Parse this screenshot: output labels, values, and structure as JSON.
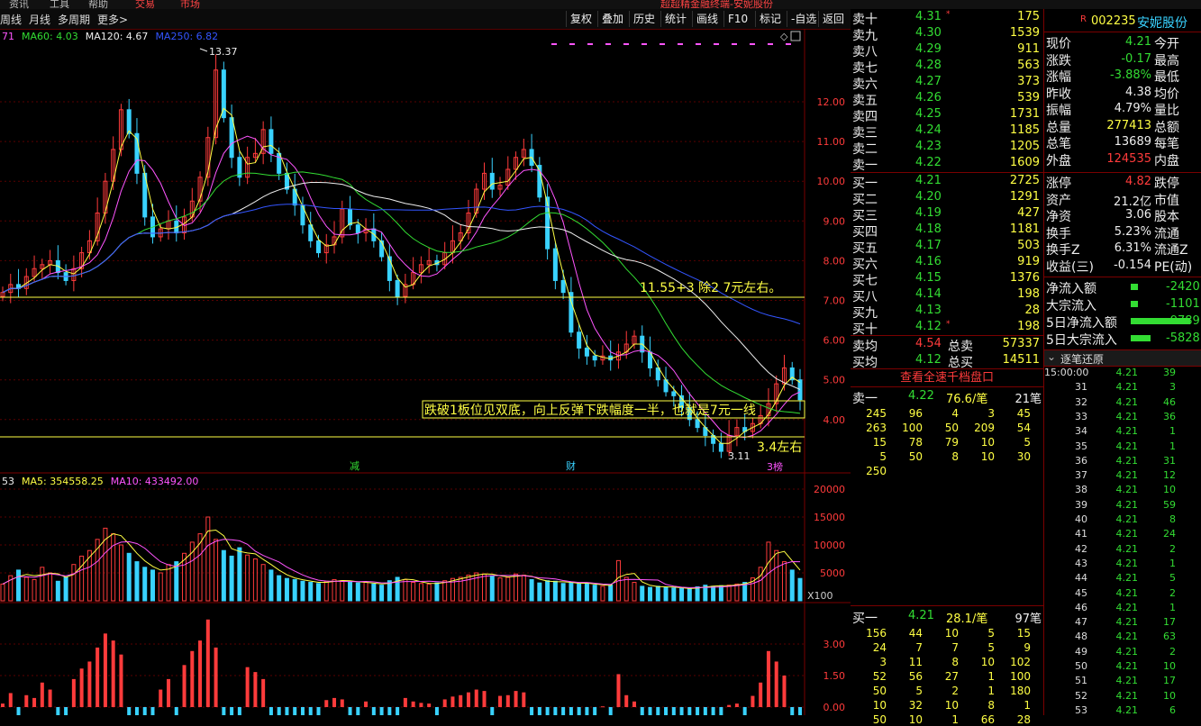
{
  "toolbar": {
    "period_tabs": [
      "周线",
      "月线",
      "多周期",
      "更多>"
    ],
    "buttons": [
      "复权",
      "叠加",
      "历史",
      "统计",
      "画线",
      "F10",
      "标记",
      "-自选",
      "返回"
    ]
  },
  "topbar": {
    "items": [
      "资讯",
      "工具",
      "帮助"
    ],
    "alerts": [
      "交易",
      "市场"
    ],
    "title": "超超精金融终端-安妮股份"
  },
  "chart": {
    "ma_legend": [
      {
        "text": "71",
        "color": "#ff55ff"
      },
      {
        "text": "MA60: 4.03",
        "color": "#33dd33"
      },
      {
        "text": "MA120: 4.67",
        "color": "#eeeeee"
      },
      {
        "text": "MA250: 6.82",
        "color": "#3355ff"
      }
    ],
    "vol_legend": [
      {
        "text": "53",
        "color": "#eeeeee"
      },
      {
        "text": "MA5: 354558.25",
        "color": "#ffff44"
      },
      {
        "text": "MA10: 433492.00",
        "color": "#ff55ff"
      }
    ],
    "high_label": "13.37",
    "low_label": "3.11",
    "annotation_1": "11.55+3  除2  7元左右。",
    "annotation_2": "跌破1板位见双底，向上反弹下跌幅度一半，也就是7元一线",
    "annotation_3": "3.4左右",
    "event_markers": [
      "减",
      "财",
      "3榜"
    ],
    "price_ticks": [
      "12.00",
      "11.00",
      "10.00",
      "9.00",
      "8.00",
      "7.00",
      "6.00",
      "5.00",
      "4.00"
    ],
    "vol_ticks": [
      "20000",
      "15000",
      "10000",
      "5000"
    ],
    "vol_unit": "X100",
    "ind_ticks": [
      "3.00",
      "1.50",
      "0.00"
    ]
  },
  "chart_data": {
    "type": "candlestick",
    "price_axis": {
      "min": 3.0,
      "max": 13.5
    },
    "close": [
      7.2,
      7.4,
      7.3,
      7.6,
      7.8,
      7.9,
      8.0,
      7.7,
      7.5,
      7.8,
      8.2,
      8.5,
      9.2,
      10.0,
      10.8,
      11.8,
      11.2,
      10.2,
      9.1,
      8.6,
      8.8,
      9.0,
      8.7,
      9.1,
      9.5,
      10.1,
      11.1,
      12.8,
      11.6,
      10.6,
      10.1,
      10.6,
      10.7,
      11.3,
      10.7,
      10.2,
      9.8,
      9.4,
      8.9,
      8.5,
      8.2,
      8.4,
      8.6,
      9.3,
      8.9,
      8.7,
      8.8,
      8.5,
      8.1,
      7.5,
      7.1,
      7.4,
      7.7,
      7.9,
      8.0,
      7.9,
      8.2,
      8.5,
      8.7,
      9.2,
      9.8,
      10.2,
      9.8,
      9.9,
      10.3,
      10.6,
      10.8,
      10.4,
      9.6,
      8.3,
      7.5,
      7.2,
      6.2,
      5.8,
      5.6,
      5.5,
      5.6,
      5.5,
      5.7,
      5.9,
      6.1,
      5.7,
      5.3,
      5.0,
      4.7,
      4.6,
      4.3,
      4.0,
      3.8,
      3.6,
      3.4,
      3.2,
      3.6,
      3.8,
      3.7,
      3.9,
      4.1,
      4.4,
      4.9,
      5.3,
      5.0,
      4.5
    ],
    "volume_axis": {
      "min": 0,
      "max": 21000
    },
    "volume": [
      3000,
      4500,
      5500,
      4200,
      3800,
      6000,
      5000,
      3500,
      4200,
      6500,
      8000,
      9000,
      11000,
      13000,
      12000,
      10000,
      8500,
      7000,
      6000,
      5500,
      5000,
      6500,
      7000,
      8500,
      10500,
      12000,
      15000,
      11000,
      9000,
      8000,
      9500,
      8200,
      7500,
      6500,
      5500,
      4500,
      4000,
      3800,
      3500,
      3300,
      3100,
      3500,
      3800,
      3600,
      3400,
      3200,
      3300,
      3000,
      2800,
      3600,
      4200,
      3800,
      3300,
      3100,
      3000,
      3200,
      3600,
      4000,
      4200,
      4600,
      5000,
      4800,
      4500,
      4100,
      4200,
      4800,
      4600,
      3800,
      3200,
      3600,
      3500,
      3100,
      3300,
      3000,
      3200,
      2800,
      2600,
      2800,
      7200,
      4200,
      3300,
      2600,
      2400,
      2600,
      2500,
      2300,
      2200,
      2100,
      2500,
      2800,
      2600,
      2700,
      2800,
      3000,
      3300,
      4100,
      6000,
      10500,
      9000,
      7000,
      5500,
      4000
    ]
  },
  "orderbook": {
    "sell": [
      {
        "label": "卖十",
        "price": "4.31",
        "vol": "175",
        "mark": "*"
      },
      {
        "label": "卖九",
        "price": "4.30",
        "vol": "1539"
      },
      {
        "label": "卖八",
        "price": "4.29",
        "vol": "911"
      },
      {
        "label": "卖七",
        "price": "4.28",
        "vol": "563"
      },
      {
        "label": "卖六",
        "price": "4.27",
        "vol": "373"
      },
      {
        "label": "卖五",
        "price": "4.26",
        "vol": "539"
      },
      {
        "label": "卖四",
        "price": "4.25",
        "vol": "1731"
      },
      {
        "label": "卖三",
        "price": "4.24",
        "vol": "1185"
      },
      {
        "label": "卖二",
        "price": "4.23",
        "vol": "1205"
      },
      {
        "label": "卖一",
        "price": "4.22",
        "vol": "1609"
      }
    ],
    "buy": [
      {
        "label": "买一",
        "price": "4.21",
        "vol": "2725"
      },
      {
        "label": "买二",
        "price": "4.20",
        "vol": "1291"
      },
      {
        "label": "买三",
        "price": "4.19",
        "vol": "427"
      },
      {
        "label": "买四",
        "price": "4.18",
        "vol": "1181"
      },
      {
        "label": "买五",
        "price": "4.17",
        "vol": "503"
      },
      {
        "label": "买六",
        "price": "4.16",
        "vol": "919"
      },
      {
        "label": "买七",
        "price": "4.15",
        "vol": "1376"
      },
      {
        "label": "买八",
        "price": "4.14",
        "vol": "198"
      },
      {
        "label": "买九",
        "price": "4.13",
        "vol": "28"
      },
      {
        "label": "买十",
        "price": "4.12",
        "vol": "198",
        "mark": "*"
      }
    ],
    "avg": [
      {
        "label": "卖均",
        "price": "4.54",
        "total_label": "总卖",
        "total": "57337"
      },
      {
        "label": "买均",
        "price": "4.12",
        "total_label": "总买",
        "total": "14511"
      }
    ]
  },
  "depth": {
    "header": "查看全速千档盘口",
    "sell_head": {
      "label": "卖一",
      "price": "4.22",
      "avg": "76.6/笔",
      "count": "21笔"
    },
    "sell_grid": [
      [
        "245",
        "96",
        "4",
        "3",
        "45"
      ],
      [
        "263",
        "100",
        "50",
        "209",
        "54"
      ],
      [
        "15",
        "78",
        "79",
        "10",
        "5"
      ],
      [
        "5",
        "50",
        "8",
        "10",
        "30"
      ],
      [
        "250",
        "",
        "",
        "",
        ""
      ]
    ],
    "buy_head": {
      "label": "买一",
      "price": "4.21",
      "avg": "28.1/笔",
      "count": "97笔"
    },
    "buy_grid": [
      [
        "156",
        "44",
        "10",
        "5",
        "15"
      ],
      [
        "24",
        "7",
        "7",
        "5",
        "9"
      ],
      [
        "3",
        "11",
        "8",
        "10",
        "102"
      ],
      [
        "52",
        "56",
        "27",
        "1",
        "100"
      ],
      [
        "50",
        "5",
        "2",
        "1",
        "180"
      ],
      [
        "10",
        "32",
        "10",
        "8",
        "1"
      ],
      [
        "50",
        "10",
        "1",
        "66",
        "28"
      ]
    ]
  },
  "quote": {
    "code": "002235",
    "name": "安妮股份",
    "rows": [
      {
        "l": "现价",
        "v": "4.21",
        "vc": "#33dd33",
        "r": "今开"
      },
      {
        "l": "涨跌",
        "v": "-0.17",
        "vc": "#33dd33",
        "r": "最高"
      },
      {
        "l": "涨幅",
        "v": "-3.88%",
        "vc": "#33dd33",
        "r": "最低"
      },
      {
        "l": "昨收",
        "v": "4.38",
        "vc": "#eeeeee",
        "r": "均价"
      },
      {
        "l": "振幅",
        "v": "4.79%",
        "vc": "#eeeeee",
        "r": "量比"
      },
      {
        "l": "总量",
        "v": "277413",
        "vc": "#ffff44",
        "r": "总额"
      },
      {
        "l": "总笔",
        "v": "13689",
        "vc": "#eeeeee",
        "r": "每笔"
      },
      {
        "l": "外盘",
        "v": "124535",
        "vc": "#ff3b3b",
        "r": "内盘"
      }
    ],
    "rows2": [
      {
        "l": "涨停",
        "v": "4.82",
        "vc": "#ff3b3b",
        "r": "跌停"
      },
      {
        "l": "资产",
        "v": "21.2亿",
        "vc": "#eeeeee",
        "r": "市值"
      },
      {
        "l": "净资",
        "v": "3.06",
        "vc": "#eeeeee",
        "r": "股本"
      },
      {
        "l": "换手",
        "v": "5.23%",
        "vc": "#eeeeee",
        "r": "流通"
      },
      {
        "l": "换手Z",
        "v": "6.31%",
        "vc": "#eeeeee",
        "r": "流通Z"
      },
      {
        "l": "收益(三)",
        "v": "-0.154",
        "vc": "#eeeeee",
        "r": "PE(动)"
      }
    ],
    "flows": [
      {
        "l": "净流入额",
        "v": "-2420"
      },
      {
        "l": "大宗流入",
        "v": "-1101"
      },
      {
        "l": "5日净流入额",
        "v": "-9789"
      },
      {
        "l": "5日大宗流入",
        "v": "-5828"
      }
    ],
    "ticks_header": "逐笔还原",
    "ticks": [
      [
        "15:00:00",
        "4.21",
        "39"
      ],
      [
        "31",
        "4.21",
        "3"
      ],
      [
        "32",
        "4.21",
        "46"
      ],
      [
        "33",
        "4.21",
        "36"
      ],
      [
        "34",
        "4.21",
        "1"
      ],
      [
        "35",
        "4.21",
        "1"
      ],
      [
        "36",
        "4.21",
        "31"
      ],
      [
        "37",
        "4.21",
        "12"
      ],
      [
        "38",
        "4.21",
        "10"
      ],
      [
        "39",
        "4.21",
        "59"
      ],
      [
        "40",
        "4.21",
        "8"
      ],
      [
        "41",
        "4.21",
        "24"
      ],
      [
        "42",
        "4.21",
        "2"
      ],
      [
        "43",
        "4.21",
        "1"
      ],
      [
        "44",
        "4.21",
        "5"
      ],
      [
        "45",
        "4.21",
        "2"
      ],
      [
        "46",
        "4.21",
        "1"
      ],
      [
        "47",
        "4.21",
        "17"
      ],
      [
        "48",
        "4.21",
        "63"
      ],
      [
        "49",
        "4.21",
        "2"
      ],
      [
        "50",
        "4.21",
        "10"
      ],
      [
        "51",
        "4.21",
        "17"
      ],
      [
        "52",
        "4.21",
        "10"
      ],
      [
        "53",
        "4.21",
        "6"
      ]
    ]
  },
  "colors": {
    "up": "#ff3b3b",
    "down": "#39d2ff",
    "ma5": "#ffff44",
    "ma10": "#ff55ff",
    "ma60": "#33dd33",
    "ma120": "#eeeeee",
    "ma250": "#3355ff"
  }
}
